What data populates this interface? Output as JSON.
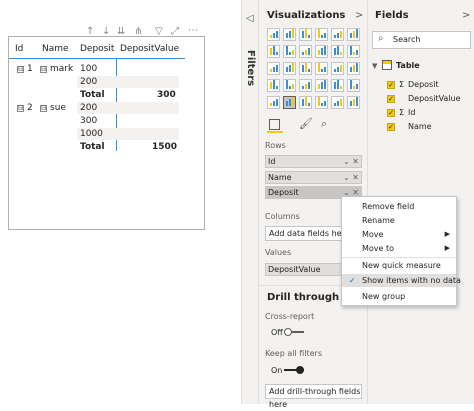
{
  "visual": {
    "headers": [
      "Id",
      "Name",
      "Deposit",
      "DepositValue"
    ],
    "rows": [
      {
        "id": "1",
        "name": "mark",
        "deposits": [
          "100",
          "200"
        ],
        "total_label": "Total",
        "total": "300"
      },
      {
        "id": "2",
        "name": "sue",
        "deposits": [
          "200",
          "300",
          "1000"
        ],
        "total_label": "Total",
        "total": "1500"
      }
    ],
    "expand_glyph": "⊟"
  },
  "filters": {
    "label": "Filters",
    "collapse_glyph": "◁"
  },
  "visualizations": {
    "title": "Visualizations",
    "chevron": ">",
    "rows_label": "Rows",
    "rows_fields": [
      "Id",
      "Name",
      "Deposit"
    ],
    "columns_label": "Columns",
    "columns_placeholder": "Add data fields here",
    "values_label": "Values",
    "values_field": "DepositValue",
    "drill_title": "Drill through",
    "cross_report_label": "Cross-report",
    "cross_report_state": "Off",
    "keep_filters_label": "Keep all filters",
    "keep_filters_state": "On",
    "drill_placeholder": "Add drill-through fields here",
    "well_controls": "⌄ ✕"
  },
  "fields": {
    "title": "Fields",
    "chevron": ">",
    "search_placeholder": "Search",
    "table_name": "Table",
    "items": [
      {
        "sigma": "Σ",
        "name": "Deposit"
      },
      {
        "sigma": "",
        "name": "DepositValue"
      },
      {
        "sigma": "Σ",
        "name": "Id"
      },
      {
        "sigma": "",
        "name": "Name"
      }
    ]
  },
  "context_menu": {
    "items": [
      "Remove field",
      "Rename",
      "Move",
      "Move to",
      "New quick measure",
      "Show items with no data",
      "New group"
    ],
    "checked": "Show items with no data",
    "submenu_glyph": "▶",
    "check_glyph": "✓"
  },
  "colors": {
    "accent": "#f2c811",
    "line_blue": "#3a8fd6",
    "pane_bg": "#f3f2f1"
  }
}
